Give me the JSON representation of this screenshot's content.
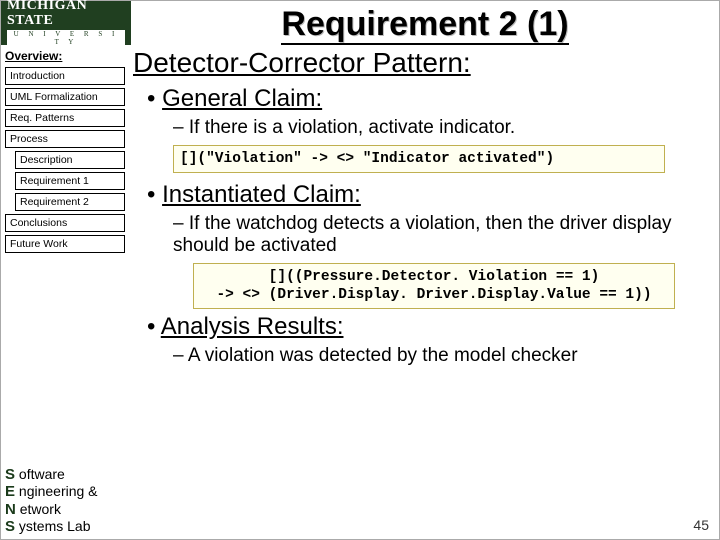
{
  "logo": {
    "line1": "MICHIGAN STATE",
    "line2": "U N I V E R S I T Y"
  },
  "title": "Requirement 2 (1)",
  "sidebar": {
    "heading": "Overview:",
    "items": [
      "Introduction",
      "UML Formalization",
      "Req. Patterns",
      "Process"
    ],
    "subitems": [
      "Description",
      "Requirement 1",
      "Requirement 2"
    ],
    "items2": [
      "Conclusions",
      "Future Work"
    ]
  },
  "content": {
    "heading": "Detector-Corrector Pattern:",
    "general_label": "General Claim:",
    "general_text": "If there is a violation, activate indicator.",
    "code1": "[](\"Violation\" -> <> \"Indicator activated\")",
    "inst_label": "Instantiated Claim:",
    "inst_text": "If the watchdog detects a violation, then the driver display should be activated",
    "code2a": "[]((Pressure.Detector. Violation == 1)",
    "code2b": "-> <> (Driver.Display. Driver.Display.Value == 1))",
    "analysis_label": "Analysis Results:",
    "analysis_text": "A violation was detected by the model checker"
  },
  "footer": {
    "s": "S",
    "s2": "oftware",
    "e": "E",
    "e2": "ngineering &",
    "n": "N",
    "n2": "etwork",
    "y": "S",
    "y2": "ystems Lab"
  },
  "slidenum": "45"
}
